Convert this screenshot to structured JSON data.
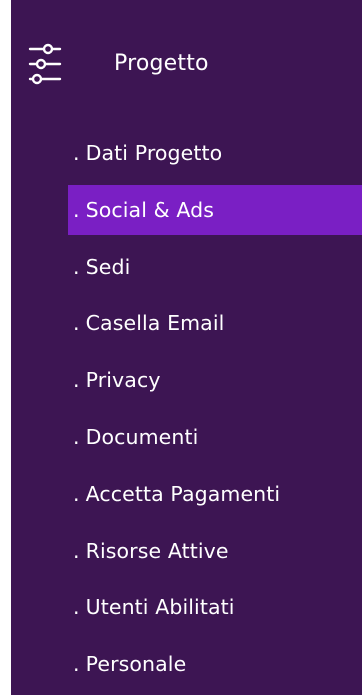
{
  "colors": {
    "panel_background": "#3d1553",
    "active_background": "#7a1fc4",
    "text": "#ffffff"
  },
  "header": {
    "icon": "sliders-icon",
    "title": "Progetto"
  },
  "menu": {
    "prefix": ".",
    "active_index": 1,
    "items": [
      {
        "label": "Dati Progetto"
      },
      {
        "label": "Social & Ads"
      },
      {
        "label": "Sedi"
      },
      {
        "label": "Casella Email"
      },
      {
        "label": "Privacy"
      },
      {
        "label": "Documenti"
      },
      {
        "label": "Accetta Pagamenti"
      },
      {
        "label": "Risorse Attive"
      },
      {
        "label": "Utenti Abilitati"
      },
      {
        "label": "Personale"
      }
    ]
  }
}
